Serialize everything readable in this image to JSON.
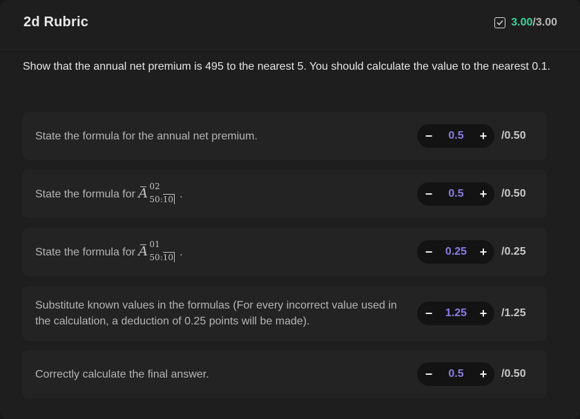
{
  "header": {
    "title": "2d Rubric",
    "score_earned": "3.00",
    "score_total": "/3.00",
    "icon": "checkbox-check-icon"
  },
  "prompt": "Show that the annual net premium is 495 to the nearest 5. You should calculate the value to the nearest 0.1.",
  "criteria": [
    {
      "text": "State the formula for the annual net premium.",
      "value": "0.5",
      "max": "/0.50"
    },
    {
      "text": "State the formula for",
      "math": {
        "sup": "02",
        "sub_pre": "50:",
        "sub_bracket": "10"
      },
      "suffix": ".",
      "value": "0.5",
      "max": "/0.50"
    },
    {
      "text": "State the formula for",
      "math": {
        "sup": "01",
        "sub_pre": "50:",
        "sub_bracket": "10"
      },
      "suffix": ".",
      "value": "0.25",
      "max": "/0.25"
    },
    {
      "text": "Substitute known values in the formulas (For every incorrect value used in the calculation, a deduction of 0.25 points will be made).",
      "value": "1.25",
      "max": "/1.25"
    },
    {
      "text": "Correctly calculate the final answer.",
      "value": "0.5",
      "max": "/0.50"
    }
  ],
  "controls": {
    "minus_label": "−",
    "plus_label": "+"
  },
  "colors": {
    "accent_green": "#3fd29c",
    "value_purple": "#8a7ee0",
    "card_bg": "#232323",
    "panel_bg": "#1e1e1e"
  }
}
